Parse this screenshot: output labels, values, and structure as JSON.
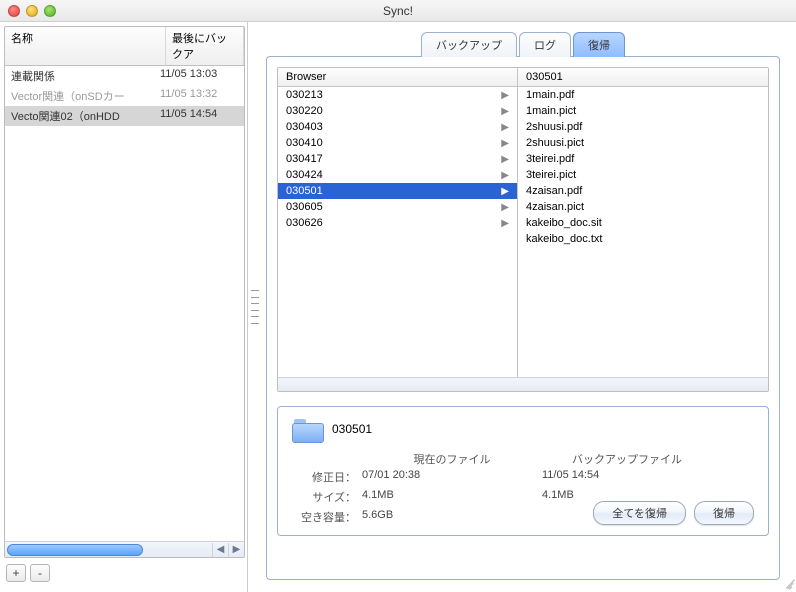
{
  "window": {
    "title": "Sync!"
  },
  "sidebar": {
    "columns": {
      "name": "名称",
      "date": "最後にバックア"
    },
    "rows": [
      {
        "name": "連載関係",
        "date": "11/05 13:03",
        "dim": false,
        "selected": false
      },
      {
        "name": "Vector関連（onSDカー",
        "date": "11/05 13:32",
        "dim": true,
        "selected": false
      },
      {
        "name": "Vecto関連02（onHDD",
        "date": "11/05 14:54",
        "dim": false,
        "selected": true
      }
    ],
    "add_label": "+",
    "remove_label": "-"
  },
  "tabs": {
    "items": [
      {
        "label": "バックアップ",
        "active": false
      },
      {
        "label": "ログ",
        "active": false
      },
      {
        "label": "復帰",
        "active": true
      }
    ]
  },
  "browser": {
    "header_left": "Browser",
    "header_right": "030501",
    "left_items": [
      {
        "label": "030213",
        "selected": false
      },
      {
        "label": "030220",
        "selected": false
      },
      {
        "label": "030403",
        "selected": false
      },
      {
        "label": "030410",
        "selected": false
      },
      {
        "label": "030417",
        "selected": false
      },
      {
        "label": "030424",
        "selected": false
      },
      {
        "label": "030501",
        "selected": true
      },
      {
        "label": "030605",
        "selected": false
      },
      {
        "label": "030626",
        "selected": false
      }
    ],
    "right_items": [
      "1main.pdf",
      "1main.pict",
      "2shuusi.pdf",
      "2shuusi.pict",
      "3teirei.pdf",
      "3teirei.pict",
      "4zaisan.pdf",
      "4zaisan.pict",
      "kakeibo_doc.sit",
      "kakeibo_doc.txt"
    ]
  },
  "info": {
    "folder_name": "030501",
    "current_header": "現在のファイル",
    "backup_header": "バックアップファイル",
    "modified_label": "修正日：",
    "modified_current": "07/01 20:38",
    "modified_backup": "11/05 14:54",
    "size_label": "サイズ：",
    "size_current": "4.1MB",
    "size_backup": "4.1MB",
    "free_label": "空き容量：",
    "free_value": "5.6GB",
    "restore_all": "全てを復帰",
    "restore": "復帰"
  }
}
